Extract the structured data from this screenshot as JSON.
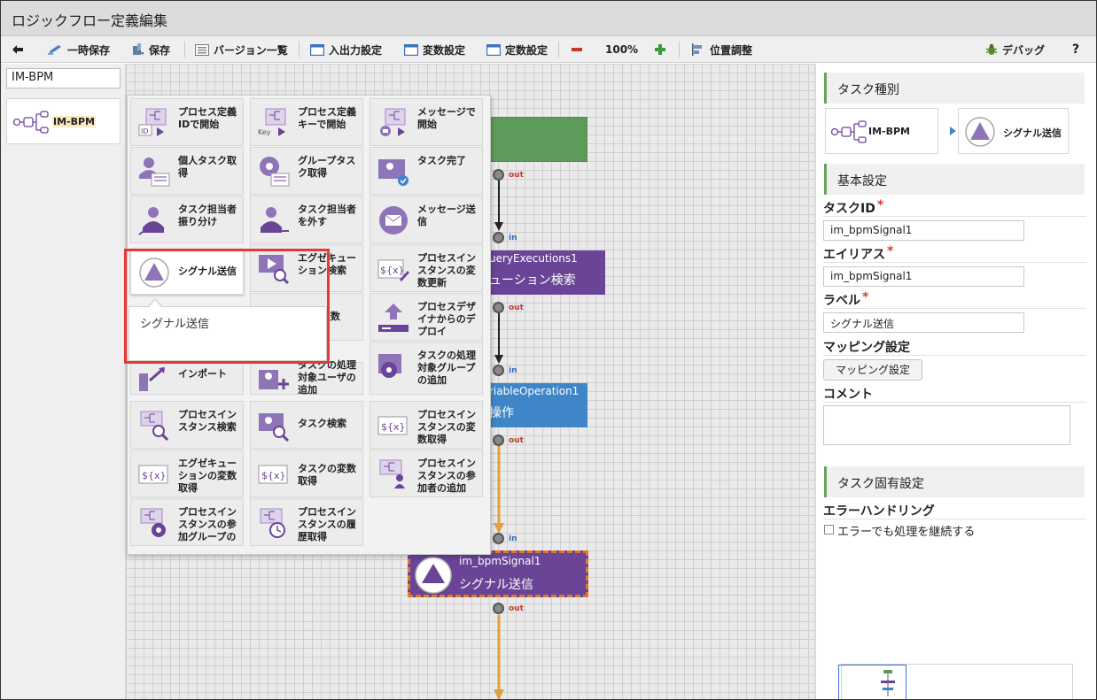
{
  "window": {
    "title": "ロジックフロー定義編集"
  },
  "toolbar": {
    "temp_save": "一時保存",
    "save": "保存",
    "version_list": "バージョン一覧",
    "io_settings": "入出力設定",
    "var_settings": "変数設定",
    "const_settings": "定数設定",
    "zoom": "100%",
    "position_adjust": "位置調整",
    "debug": "デバッグ",
    "help": "?"
  },
  "left_panel": {
    "search_value": "IM-BPM",
    "category_label": "IM-BPM"
  },
  "palette": {
    "items": [
      "プロセス定義IDで開始",
      "プロセス定義キーで開始",
      "メッセージで開始",
      "個人タスク取得",
      "グループタスク取得",
      "タスク完了",
      "タスク担当者振り分け",
      "タスク担当者を外す",
      "メッセージ送信",
      "シグナル送信",
      "エグゼキューション検索",
      "プロセスインスタンスの変数更新",
      "の変数",
      "プロセスデザイナからのデプロイ",
      "インポート",
      "タスクの処理対象ユーザの追加",
      "タスクの処理対象グループの追加",
      "プロセスインスタンス検索",
      "タスク検索",
      "プロセスインスタンスの変数取得",
      "エグゼキューションの変数取得",
      "タスクの変数取得",
      "プロセスインスタンスの参加者の追加",
      "プロセスインスタンスの参加グループの",
      "プロセスインスタンスの履歴取得"
    ],
    "tooltip": "シグナル送信",
    "id_badge": "ID",
    "key_badge": "Key",
    "var_badge": "${x}"
  },
  "canvas": {
    "node1": {
      "head": "ueryExecutions1",
      "body": "ューション検索"
    },
    "node2": {
      "head": "riableOperation1",
      "body": "操作"
    },
    "node3": {
      "head": "im_bpmSignal1",
      "body": "シグナル送信"
    },
    "port_out": "out",
    "port_in": "in"
  },
  "right_panel": {
    "task_type": {
      "title": "タスク種別",
      "category": "IM-BPM",
      "task": "シグナル送信"
    },
    "basic": {
      "title": "基本設定",
      "task_id_label": "タスクID",
      "task_id_value": "im_bpmSignal1",
      "alias_label": "エイリアス",
      "alias_value": "im_bpmSignal1",
      "label_label": "ラベル",
      "label_value": "シグナル送信",
      "required_mark": "*",
      "mapping_label": "マッピング設定",
      "mapping_button": "マッピング設定",
      "comment_label": "コメント"
    },
    "specific": {
      "title": "タスク固有設定",
      "error_label": "エラーハンドリング",
      "continue_on_error": "エラーでも処理を継続する"
    }
  },
  "colors": {
    "purple": "#6a4497",
    "blue": "#3f86c8",
    "green": "#5e9b5a",
    "highlight": "#e53935"
  }
}
